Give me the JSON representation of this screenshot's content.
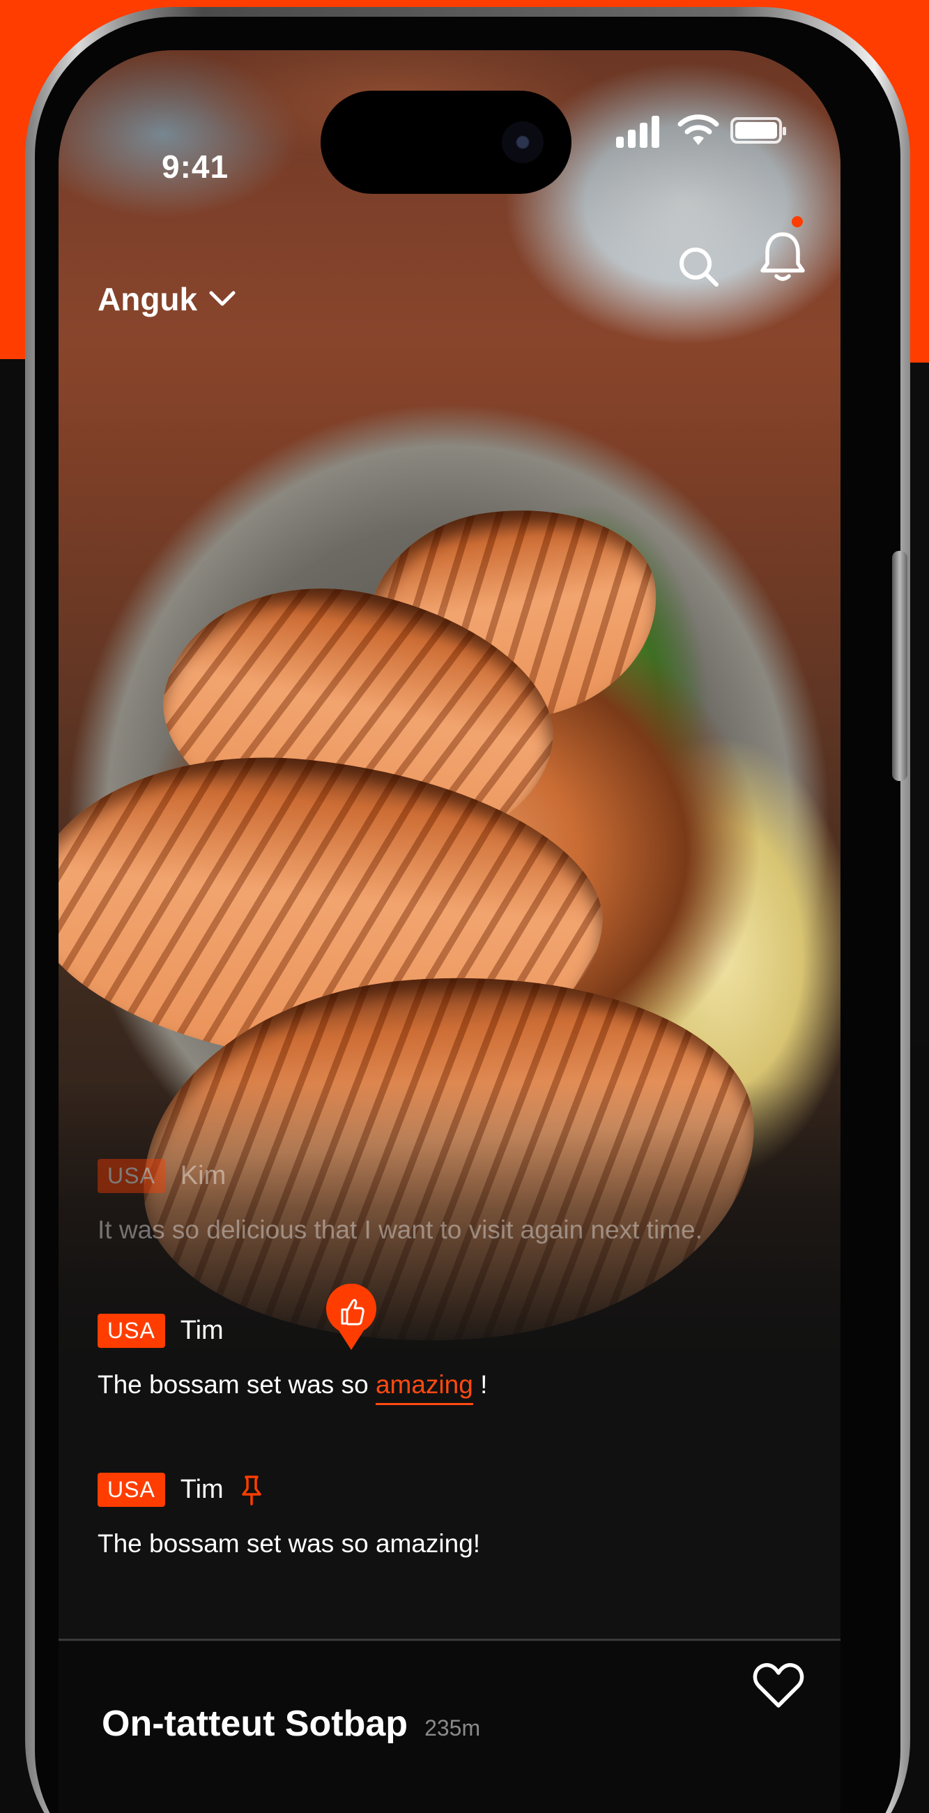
{
  "status_bar": {
    "time": "9:41"
  },
  "header": {
    "location": "Anguk",
    "icons": [
      "chevron-down-icon",
      "search-icon",
      "bell-icon"
    ],
    "notification_dot_color": "#ff3d00"
  },
  "reviews": [
    {
      "country": "USA",
      "user": "Kim",
      "text": "It was so delicious that I want to visit again next time."
    },
    {
      "country": "USA",
      "user": "Tim",
      "text_before": "The bossam set was so ",
      "highlight": "amazing",
      "text_after": " !"
    },
    {
      "country": "USA",
      "user": "Tim",
      "pinned": true,
      "text": "The bossam set was so amazing!"
    }
  ],
  "place": {
    "name": "On-tatteut Sotbap",
    "distance": "235m"
  },
  "colors": {
    "accent": "#ff3d00",
    "background": "#0d0d0d",
    "muted_text": "#8a8a8a"
  }
}
